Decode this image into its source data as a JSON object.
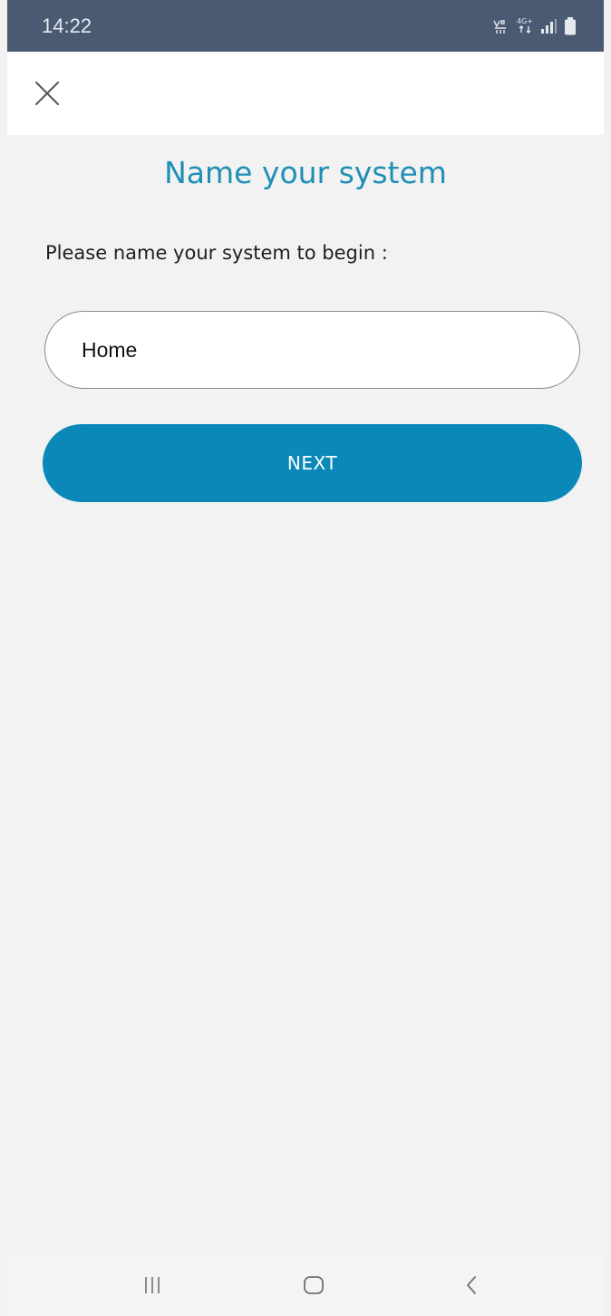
{
  "status_bar": {
    "time": "14:22",
    "network_label": "4G+",
    "icons": [
      "vowifi-icon",
      "network-speed-icon",
      "signal-icon",
      "battery-icon"
    ]
  },
  "app_bar": {
    "close_icon": "close-icon"
  },
  "main": {
    "title": "Name your system",
    "prompt": "Please name your system to begin :",
    "name_input": {
      "value": "Home",
      "placeholder": ""
    },
    "next_button": "NEXT"
  },
  "nav_bar": {
    "icons": [
      "recent-apps-icon",
      "home-icon",
      "back-icon"
    ]
  },
  "colors": {
    "accent": "#0a89b9",
    "title": "#1f8fb6",
    "status_bar": "#4a5a72",
    "background": "#f2f2f2"
  }
}
